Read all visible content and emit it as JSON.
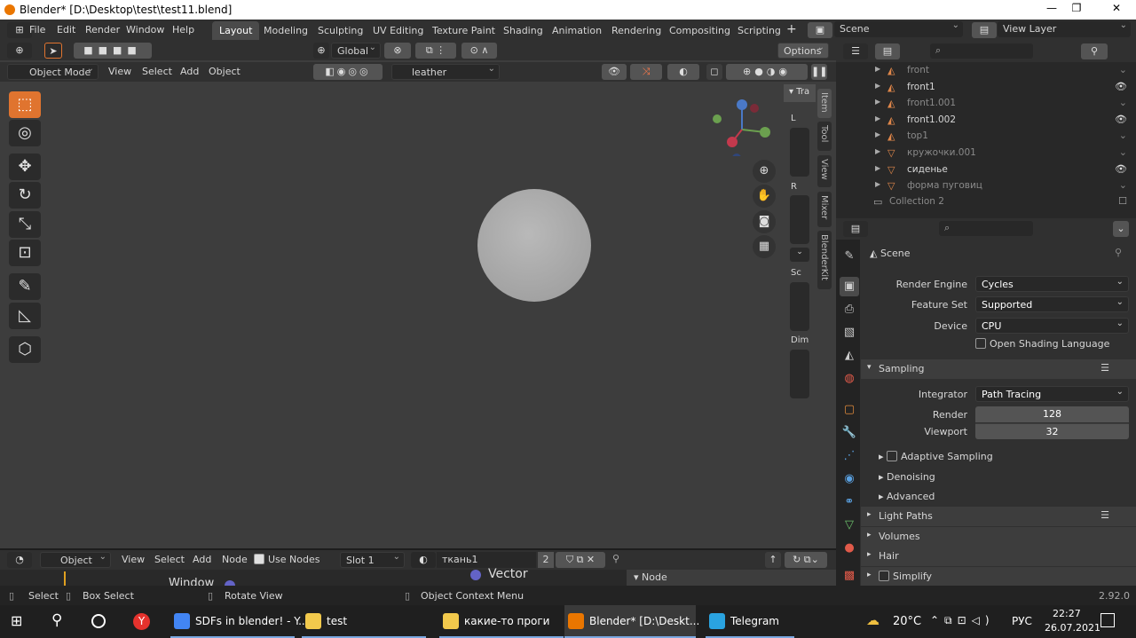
{
  "title": "Blender* [D:\\Desktop\\test\\test11.blend]",
  "window_controls": [
    "—",
    "❐",
    "✕"
  ],
  "menu": [
    "File",
    "Edit",
    "Render",
    "Window",
    "Help"
  ],
  "workspaces": [
    "Layout",
    "Modeling",
    "Sculpting",
    "UV Editing",
    "Texture Paint",
    "Shading",
    "Animation",
    "Rendering",
    "Compositing",
    "Scripting"
  ],
  "active_workspace": "Layout",
  "scene_name": "Scene",
  "view_layer": "View Layer",
  "viewport": {
    "transform_orientation": "Global",
    "options_label": "Options",
    "mode": "Object Mode",
    "header_menu": [
      "View",
      "Select",
      "Add",
      "Object"
    ],
    "material_search": "leather",
    "sidebar_tabs": [
      "Item",
      "Tool",
      "View",
      "Mixer",
      "BlenderKit"
    ],
    "sidebar_panel_title": "Tra",
    "sidebar_labels": [
      "L",
      "R",
      "Sc",
      "Dim"
    ]
  },
  "outliner": {
    "items": [
      {
        "name": "front",
        "dim": true,
        "icon": "image-icon",
        "eye": false
      },
      {
        "name": "front1",
        "dim": false,
        "icon": "image-icon",
        "eye": true
      },
      {
        "name": "front1.001",
        "dim": true,
        "icon": "image-icon",
        "eye": false
      },
      {
        "name": "front1.002",
        "dim": false,
        "icon": "image-icon",
        "eye": true
      },
      {
        "name": "top1",
        "dim": true,
        "icon": "image-icon",
        "eye": false
      },
      {
        "name": "кружочки.001",
        "dim": true,
        "icon": "mesh-icon",
        "eye": false
      },
      {
        "name": "сиденье",
        "dim": false,
        "icon": "mesh-icon",
        "eye": true
      },
      {
        "name": "форма пуговиц",
        "dim": true,
        "icon": "mesh-icon",
        "eye": false
      }
    ],
    "collection": "Collection 2"
  },
  "properties": {
    "header": "Scene",
    "render_engine_label": "Render Engine",
    "render_engine": "Cycles",
    "feature_set_label": "Feature Set",
    "feature_set": "Supported",
    "device_label": "Device",
    "device": "CPU",
    "osl_label": "Open Shading Language",
    "sampling_label": "Sampling",
    "integrator_label": "Integrator",
    "integrator": "Path Tracing",
    "render_samples_label": "Render",
    "render_samples": "128",
    "viewport_samples_label": "Viewport",
    "viewport_samples": "32",
    "adaptive_sampling": "Adaptive Sampling",
    "denoising": "Denoising",
    "advanced": "Advanced",
    "light_paths": "Light Paths",
    "volumes": "Volumes",
    "hair": "Hair",
    "simplify": "Simplify"
  },
  "node_editor": {
    "type": "Object",
    "menu": [
      "View",
      "Select",
      "Add",
      "Node"
    ],
    "use_nodes": "Use Nodes",
    "slot": "Slot 1",
    "material": "ткань1",
    "users": "2",
    "node_text_window": "Window",
    "node_text_vector": "Vector",
    "panel_node": "Node"
  },
  "statusbar": {
    "select": "Select",
    "box_select": "Box Select",
    "rotate_view": "Rotate View",
    "context_menu": "Object Context Menu",
    "version": "2.92.0"
  },
  "taskbar": {
    "apps": [
      {
        "label": "SDFs in blender! - Y...",
        "color": "#4285f4"
      },
      {
        "label": "test",
        "color": "#f2c94c"
      },
      {
        "label": "какие-то проги",
        "color": "#f2c94c"
      },
      {
        "label": "Blender* [D:\\Deskt...",
        "color": "#ea7600"
      },
      {
        "label": "Telegram",
        "color": "#2aa3e0"
      }
    ],
    "weather": "20°C",
    "lang": "РУС",
    "time": "22:27",
    "date": "26.07.2021"
  }
}
